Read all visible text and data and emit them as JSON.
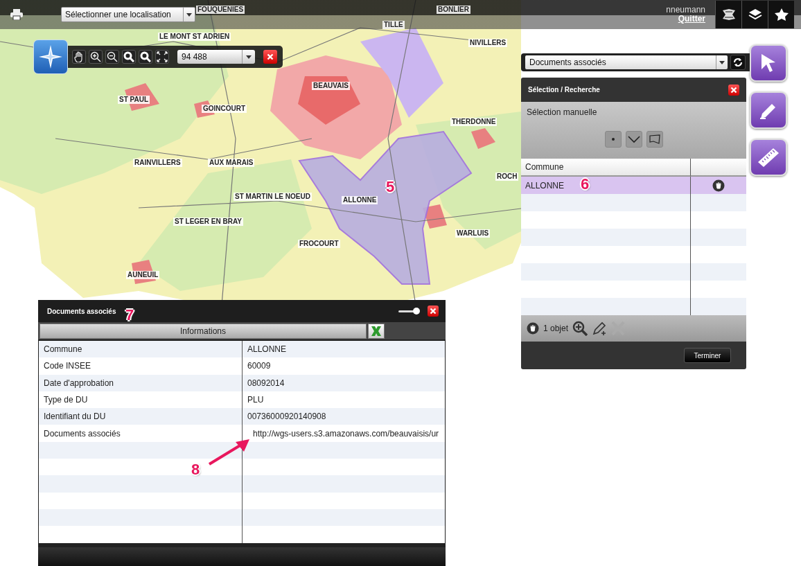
{
  "top_bar": {
    "location_select": "Sélectionner une localisation",
    "user": "nneumann",
    "logout": "Quitter"
  },
  "map": {
    "place_labels": [
      "FOUQUENIES",
      "BONLIER",
      "TILLE",
      "NIVILLERS",
      "LE MONT ST ADRIEN",
      "BEAUVAIS",
      "ST PAUL",
      "GOINCOURT",
      "THERDONNE",
      "RAINVILLERS",
      "AUX MARAIS",
      "ST MARTIN LE NOEUD",
      "ALLONNE",
      "ROCH",
      "ST LEGER EN BRAY",
      "WARLUIS",
      "FROCOURT",
      "AUNEUIL"
    ]
  },
  "map_toolbar": {
    "scale": "94 488"
  },
  "layer_select": "Documents associés",
  "selection_panel": {
    "title": "Sélection / Recherche",
    "mode_label": "Sélection manuelle",
    "columns": [
      "Commune"
    ],
    "rows": [
      {
        "commune": "ALLONNE",
        "selected": true
      }
    ],
    "count": "1 objet",
    "finish_button": "Terminer"
  },
  "info_panel": {
    "title": "Documents associés",
    "tab": "Informations",
    "opacity_slider": {
      "level": 0.85
    },
    "rows": [
      {
        "label": "Commune",
        "value": "ALLONNE",
        "kind": "text"
      },
      {
        "label": "Code INSEE",
        "value": "60009",
        "kind": "text"
      },
      {
        "label": "Date d'approbation",
        "value": "08092014",
        "kind": "text"
      },
      {
        "label": "Type de DU",
        "value": "PLU",
        "kind": "text"
      },
      {
        "label": "Identifiant du DU",
        "value": "00736000920140908",
        "kind": "text"
      },
      {
        "label": "Documents associés",
        "value": "http://wgs-users.s3.amazonaws.com/beauvaisis/ur",
        "kind": "link"
      }
    ]
  },
  "callouts": [
    "5",
    "6",
    "7",
    "8"
  ]
}
